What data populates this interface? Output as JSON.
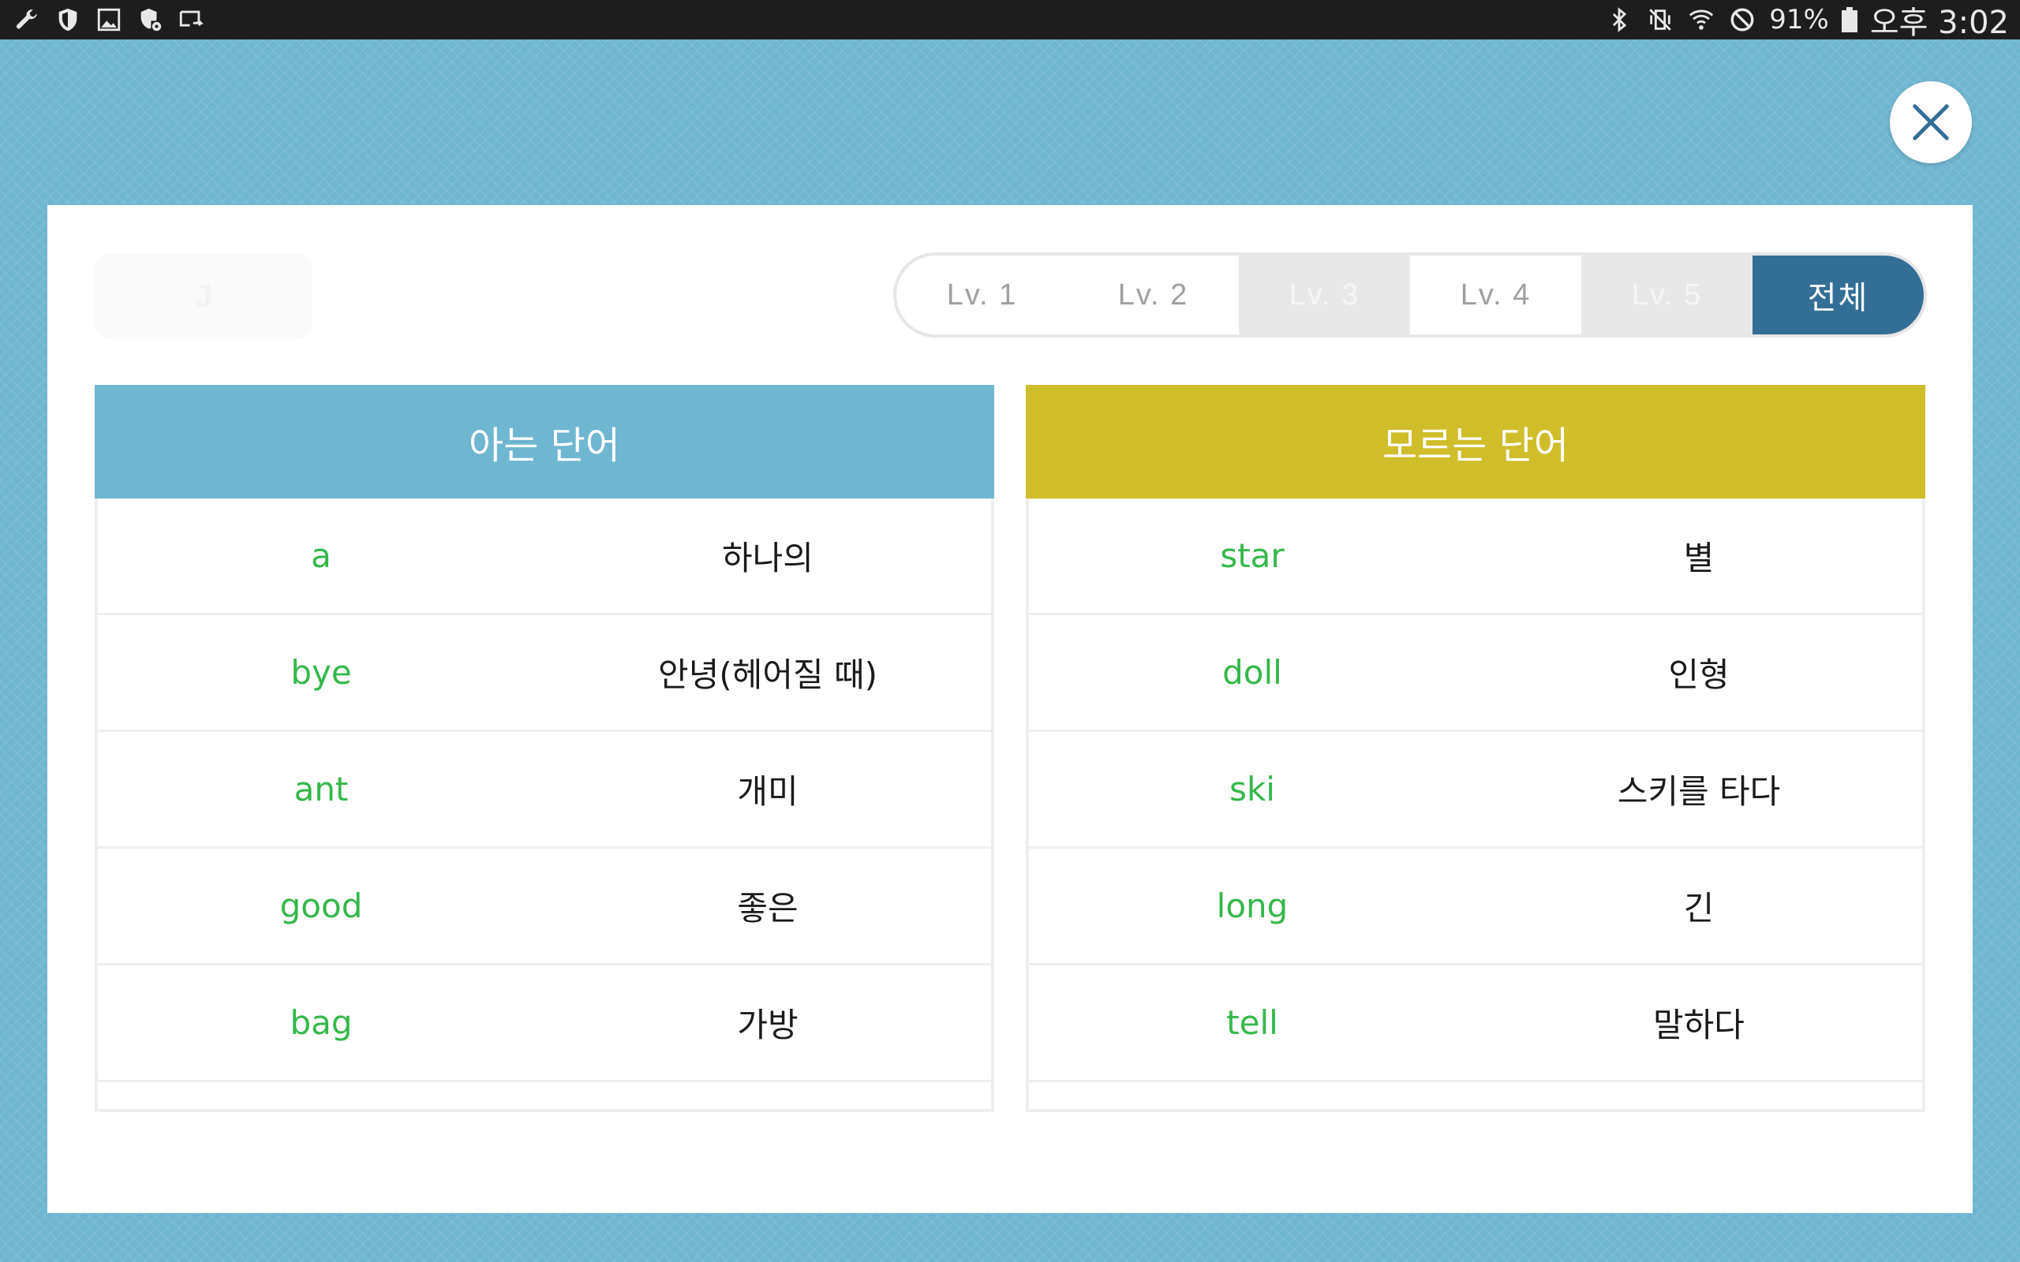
{
  "status_bar": {
    "left_icons": [
      "wrench-icon",
      "shield-icon",
      "image-icon",
      "shield-gear-icon",
      "screen-mirror-icon"
    ],
    "right_icons": [
      "bluetooth-icon",
      "vibrate-off-icon",
      "wifi-icon",
      "do-not-disturb-icon"
    ],
    "battery_percent": "91%",
    "time": "오후 3:02"
  },
  "close_button": {
    "icon": "close-icon"
  },
  "ghost_logo": {
    "text": "J"
  },
  "level_tabs": [
    {
      "label": "Lv. 1",
      "state": "normal"
    },
    {
      "label": "Lv. 2",
      "state": "normal"
    },
    {
      "label": "Lv. 3",
      "state": "dim"
    },
    {
      "label": "Lv. 4",
      "state": "normal"
    },
    {
      "label": "Lv. 5",
      "state": "dim"
    },
    {
      "label": "전체",
      "state": "active"
    }
  ],
  "known_words": {
    "title": "아는 단어",
    "rows": [
      {
        "en": "a",
        "ko": "하나의"
      },
      {
        "en": "bye",
        "ko": "안녕(헤어질 때)"
      },
      {
        "en": "ant",
        "ko": "개미"
      },
      {
        "en": "good",
        "ko": "좋은"
      },
      {
        "en": "bag",
        "ko": "가방"
      }
    ]
  },
  "unknown_words": {
    "title": "모르는 단어",
    "rows": [
      {
        "en": "star",
        "ko": "별"
      },
      {
        "en": "doll",
        "ko": "인형"
      },
      {
        "en": "ski",
        "ko": "스키를 타다"
      },
      {
        "en": "long",
        "ko": "긴"
      },
      {
        "en": "tell",
        "ko": "말하다"
      }
    ]
  },
  "colors": {
    "background": "#6fb6d1",
    "known_header": "#6fb6d1",
    "unknown_header": "#d0bd2a",
    "active_tab": "#336e96",
    "english_word": "#35b84a"
  }
}
